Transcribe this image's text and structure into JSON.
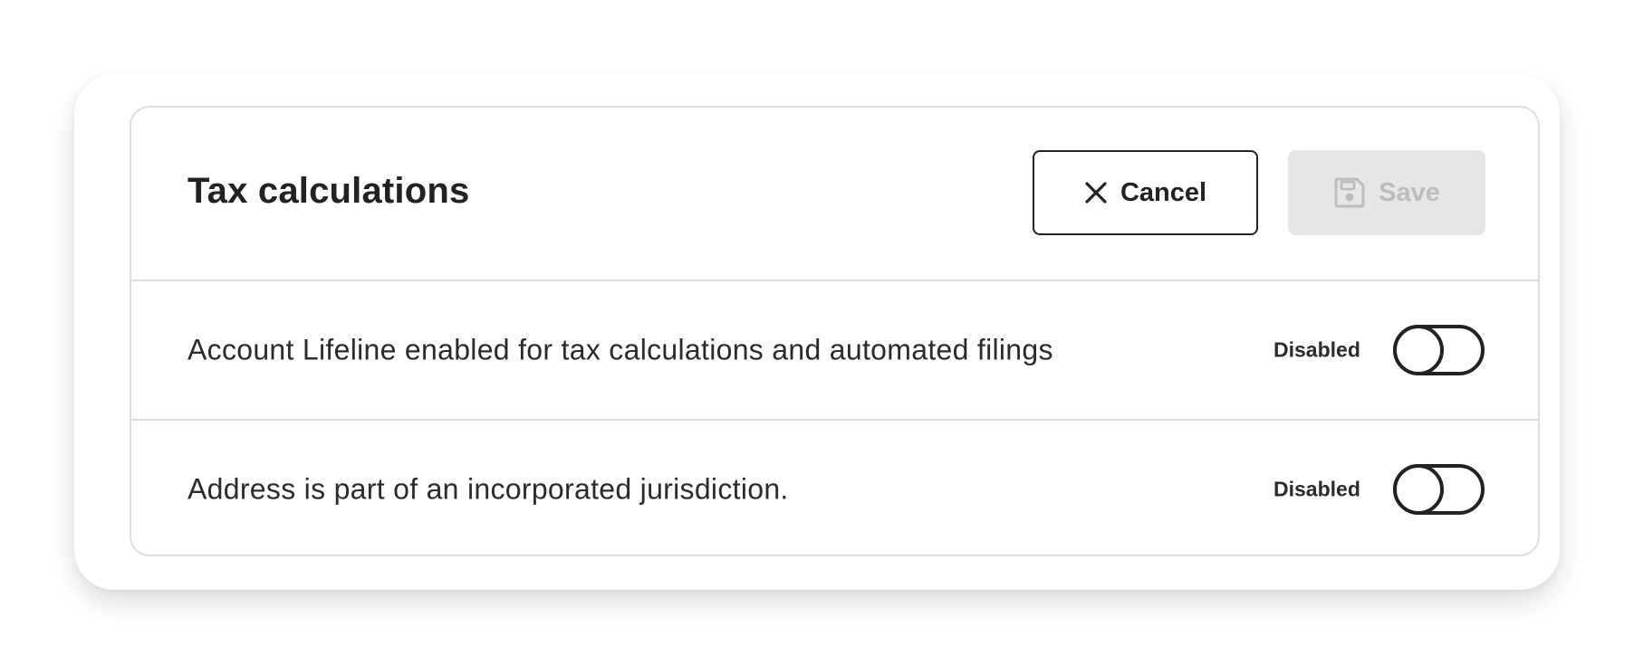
{
  "card": {
    "title": "Tax calculations",
    "actions": {
      "cancel": {
        "label": "Cancel",
        "icon": "close-icon"
      },
      "save": {
        "label": "Save",
        "icon": "floppy-disk-icon",
        "disabled": true
      }
    }
  },
  "settings": [
    {
      "label": "Account Lifeline enabled for tax calculations and automated filings",
      "status": "Disabled",
      "enabled": false
    },
    {
      "label": "Address is part of an incorporated jurisdiction.",
      "status": "Disabled",
      "enabled": false
    }
  ],
  "colors": {
    "text": "#222222",
    "border": "#dedede",
    "save_disabled_bg": "#e6e6e6",
    "save_disabled_text": "#bdbdbd"
  }
}
